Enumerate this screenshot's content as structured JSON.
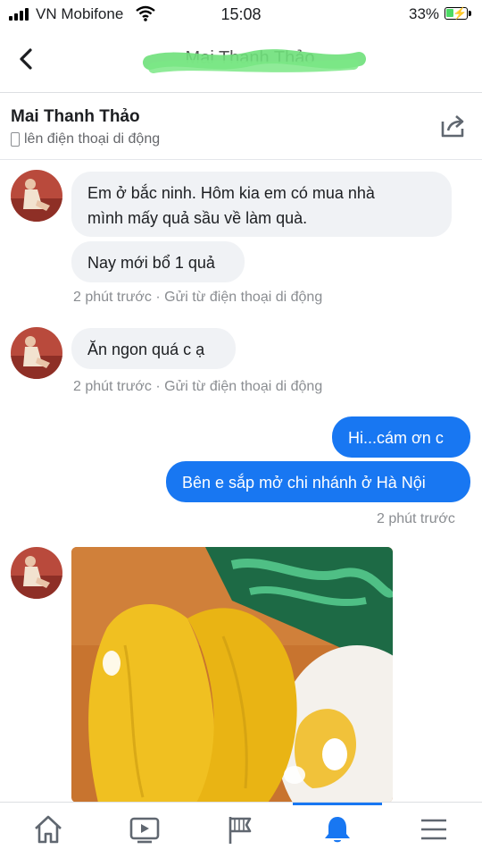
{
  "status_bar": {
    "carrier": "VN Mobifone",
    "time": "15:08",
    "battery": "33%"
  },
  "header": {
    "title": "Mai Thanh Thảo"
  },
  "profile": {
    "name": "Mai Thanh Thảo",
    "subtitle": "lên điện thoại di động"
  },
  "messages": [
    {
      "text": "Em ở bắc ninh. Hôm kia em có mua nhà\nmình mấy quả sầu về làm quà."
    },
    {
      "text": "Nay mới bổ 1 quả"
    },
    {
      "meta": "2 phút trước · Gửi từ điện thoại di động"
    },
    {
      "text": "Ăn ngon quá c ạ"
    },
    {
      "meta": "2 phút trước · Gửi từ điện thoại di động"
    },
    {
      "text": "Hi...cám ơn c"
    },
    {
      "text": "Bên e sắp mở chi nhánh ở Hà Nội"
    },
    {
      "meta": "2 phút trước"
    }
  ],
  "colors": {
    "accent": "#1877f2",
    "incoming_bubble": "#f0f2f5",
    "meta_text": "#8a8d91"
  },
  "nav": {
    "items": [
      "home-icon",
      "video-icon",
      "pages-flag-icon",
      "notifications-bell-icon",
      "menu-icon"
    ],
    "active": "notifications-bell-icon"
  }
}
